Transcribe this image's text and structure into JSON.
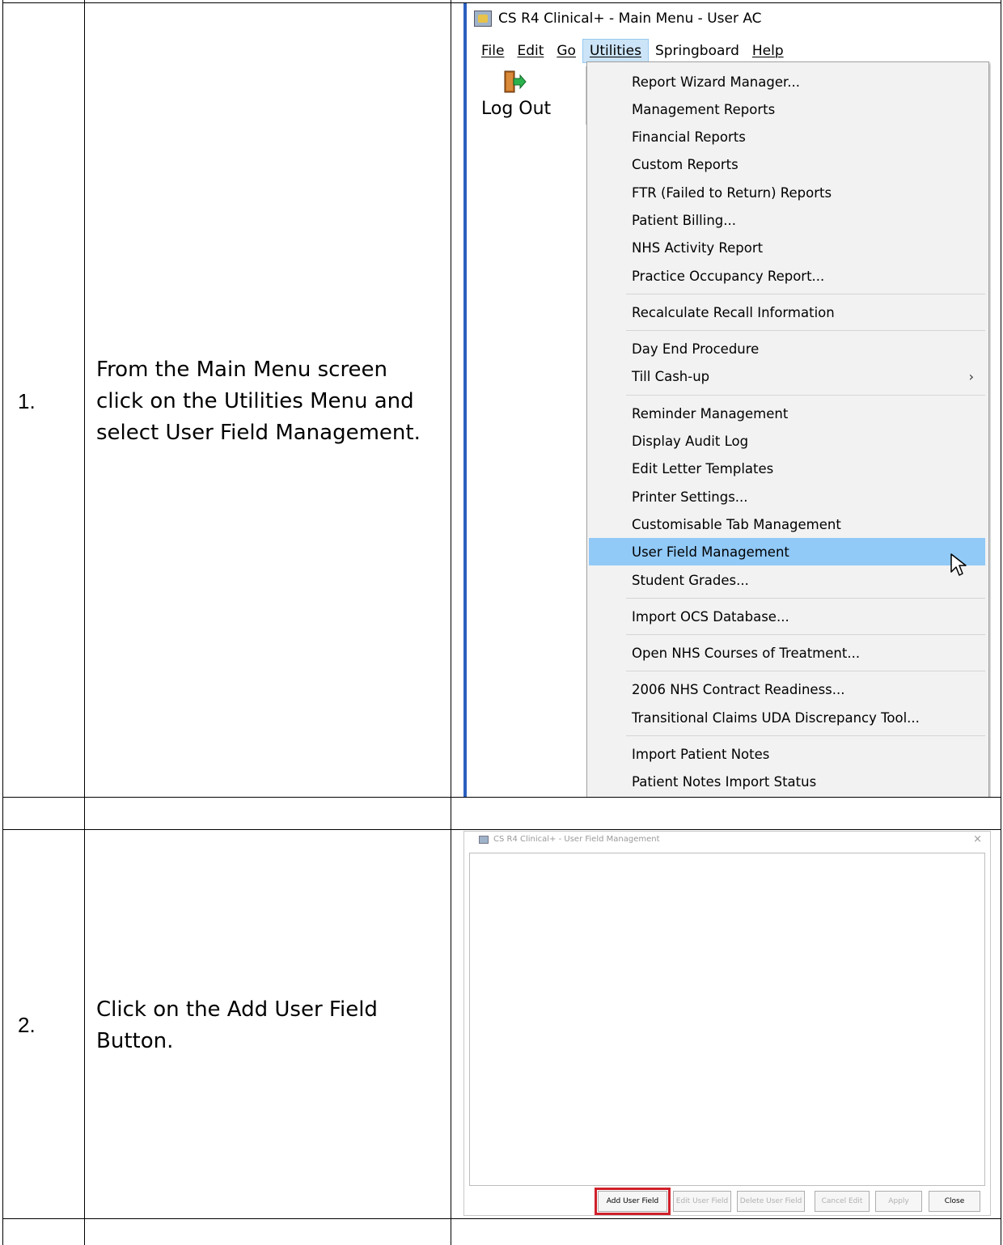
{
  "steps": [
    {
      "number": "1.",
      "text": "From the Main Menu screen click on the Utilities Menu and select User Field Management."
    },
    {
      "number": "2.",
      "text": "Click on the Add User Field Button."
    }
  ],
  "main_menu": {
    "title": "CS R4 Clinical+ - Main Menu - User AC",
    "menus": [
      "File",
      "Edit",
      "Go",
      "Utilities",
      "Springboard",
      "Help"
    ],
    "active_menu": "Utilities",
    "toolbar": {
      "logout_label": "Log Out"
    },
    "utilities_items": [
      "Report Wizard Manager...",
      "Management Reports",
      "Financial Reports",
      "Custom Reports",
      "FTR (Failed to Return) Reports",
      "Patient Billing...",
      "NHS Activity Report",
      "Practice Occupancy Report...",
      "Recalculate Recall Information",
      "Day End Procedure",
      "Till Cash-up",
      "Reminder Management",
      "Display Audit Log",
      "Edit Letter Templates",
      "Printer Settings...",
      "Customisable Tab Management",
      "User Field Management",
      "Student Grades...",
      "Import OCS Database...",
      "Open NHS Courses of Treatment...",
      "2006 NHS Contract Readiness...",
      "Transitional Claims UDA Discrepancy Tool...",
      "Import Patient Notes",
      "Patient Notes Import Status"
    ],
    "selected_item": "User Field Management",
    "submenu_arrow": "›"
  },
  "user_field_window": {
    "title": "CS R4 Clinical+ - User Field Management",
    "close_glyph": "×",
    "buttons": {
      "add": "Add User Field",
      "edit": "Edit User Field",
      "delete": "Delete User Field",
      "cancel": "Cancel Edit",
      "apply": "Apply",
      "close": "Close"
    },
    "highlight_color": "#d0202a"
  }
}
